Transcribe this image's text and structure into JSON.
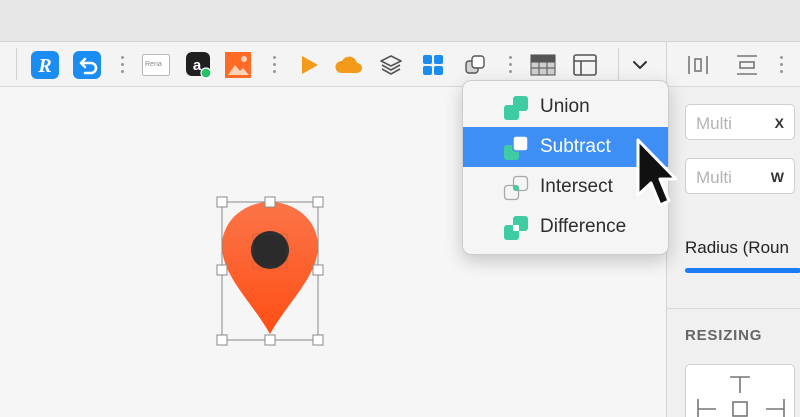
{
  "colors": {
    "accent": "#3d8ff6",
    "shape_green": "#3ecca2",
    "pin_top": "#fb7548",
    "pin_bottom": "#ff5a1f"
  },
  "toolbar": {
    "rename_text": "Rena"
  },
  "boolean_menu": {
    "items": [
      {
        "label": "Union",
        "icon": "union-icon"
      },
      {
        "label": "Subtract",
        "icon": "subtract-icon",
        "selected": true
      },
      {
        "label": "Intersect",
        "icon": "intersect-icon"
      },
      {
        "label": "Difference",
        "icon": "difference-icon"
      }
    ]
  },
  "inspector": {
    "x_field": {
      "placeholder": "Multi",
      "tag": "X"
    },
    "w_field": {
      "placeholder": "Multi",
      "tag": "W"
    },
    "radius_label": "Radius (Roun",
    "section_title": "RESIZING"
  }
}
